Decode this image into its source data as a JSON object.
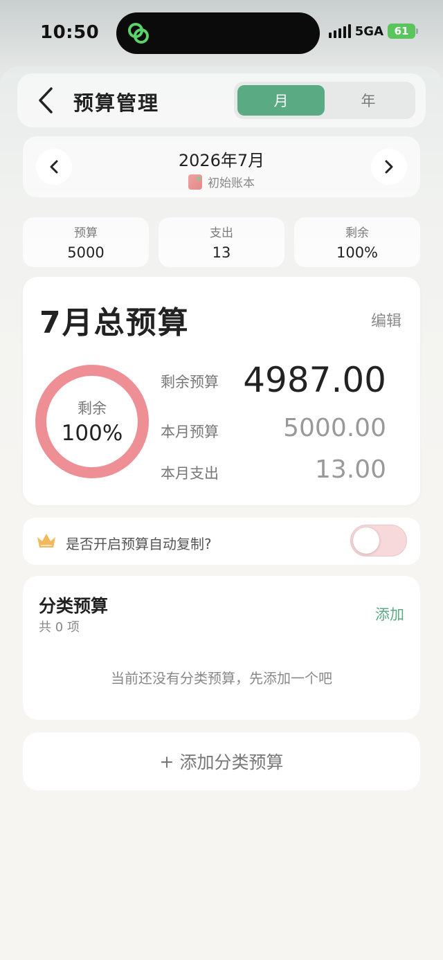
{
  "status": {
    "time": "10:50",
    "network": "5GA",
    "battery": "61"
  },
  "header": {
    "title": "预算管理",
    "tabs": [
      {
        "label": "月",
        "active": true
      },
      {
        "label": "年",
        "active": false
      }
    ]
  },
  "period": {
    "month": "2026年7月",
    "book": "初始账本"
  },
  "stats": [
    {
      "label": "预算",
      "value": "5000"
    },
    {
      "label": "支出",
      "value": "13"
    },
    {
      "label": "剩余",
      "value": "100%"
    }
  ],
  "total_budget": {
    "title": "7月总预算",
    "edit_label": "编辑",
    "ring_label": "剩余",
    "ring_value": "100%",
    "ring_fraction": 1.0,
    "remaining_label": "剩余预算",
    "remaining_value": "4987.00",
    "budget_label": "本月预算",
    "budget_value": "5000.00",
    "spent_label": "本月支出",
    "spent_value": "13.00"
  },
  "auto_copy": {
    "label": "是否开启预算自动复制?",
    "enabled": false
  },
  "category_budget": {
    "title": "分类预算",
    "count_text": "共 0 项",
    "add_label": "添加",
    "empty_text": "当前还没有分类预算，先添加一个吧"
  },
  "add_category_button": {
    "icon": "+",
    "label": "添加分类预算"
  },
  "colors": {
    "accent": "#5aab83",
    "ring": "#ee8f95",
    "toggle_off": "#f7d9db"
  }
}
